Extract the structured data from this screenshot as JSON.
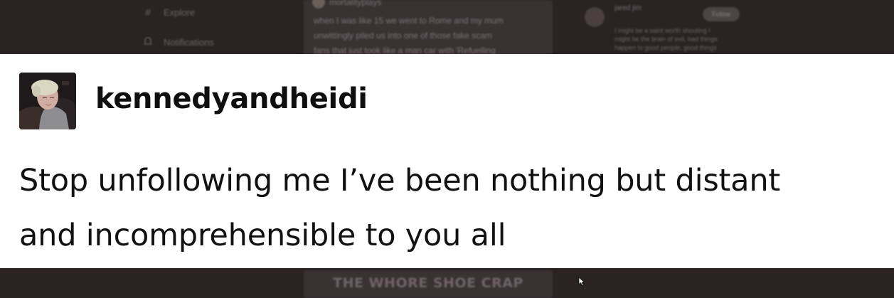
{
  "background": {
    "nav": [
      {
        "icon": "hash-icon",
        "label": "Explore"
      },
      {
        "icon": "bell-icon",
        "label": "Notifications"
      }
    ],
    "feed_card": {
      "author": "mortalityplays",
      "lines": [
        "when I was like 15 we went to Rome and my mum",
        "unwittingly piled us into one of those fake scam",
        "fans that just took like a man car with 'Refuelling"
      ]
    },
    "suggestion": {
      "name": "jared jim",
      "lines": [
        "I might be a saint worth shouting I",
        "might be the brain of evil, bad things",
        "happen to good people, good things"
      ],
      "follow_label": "Follow"
    },
    "bottom_caption": "THE WHORE SHOE CRAP"
  },
  "post": {
    "username": "kennedyandheidi",
    "text_line1": "Stop unfollowing me I’ve been nothing but distant",
    "text_line2": "and incomprehensible to you all"
  },
  "colors": {
    "background": "#2b2224",
    "post_background": "#ffffff",
    "text": "#111111"
  }
}
